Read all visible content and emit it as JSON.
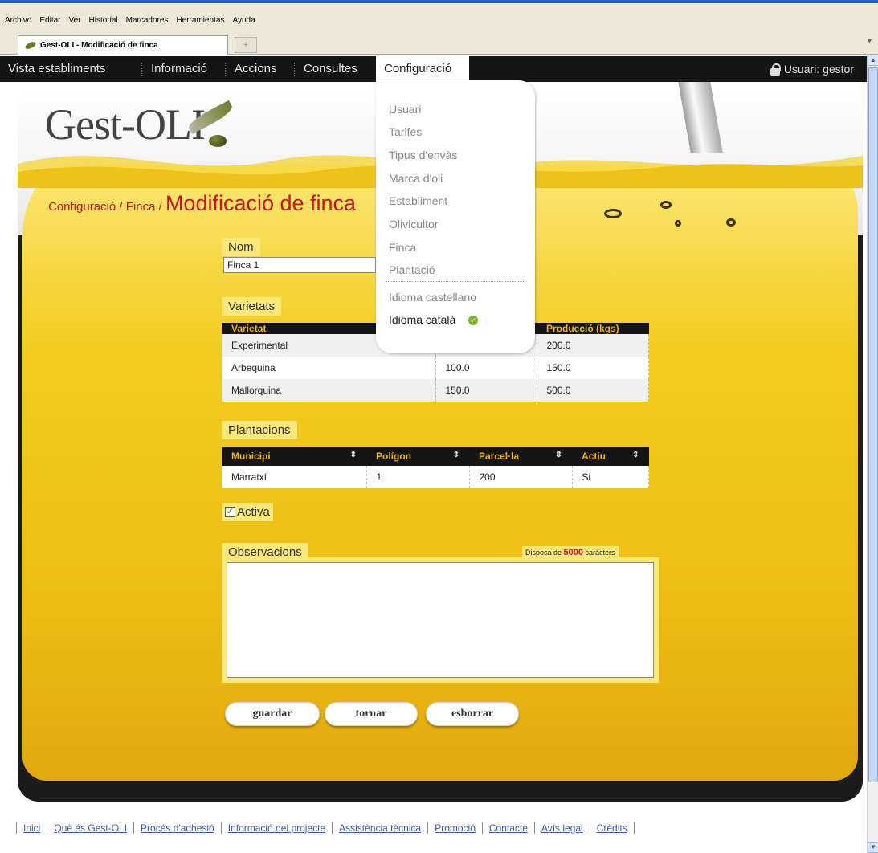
{
  "browser": {
    "menus": [
      "Archivo",
      "Editar",
      "Ver",
      "Historial",
      "Marcadores",
      "Herramientas",
      "Ayuda"
    ],
    "tab_title": "Gest-OLI - Modificació de finca",
    "new_tab": "+"
  },
  "nav": {
    "items": [
      "Vista establiments",
      "Informació",
      "Accions",
      "Consultes",
      "Configuració"
    ],
    "user_label": "Usuari: gestor"
  },
  "logo": "Gest-OLI",
  "breadcrumb": {
    "part1": "Configuració",
    "sep1": " / ",
    "part2": "Finca",
    "sep2": " / ",
    "title": "Modificació de finca"
  },
  "form": {
    "nom_label": "Nom",
    "nom_value": "Finca 1",
    "varietats_label": "Varietats",
    "plantacions_label": "Plantacions",
    "activa_label": "Activa",
    "activa_checked": true,
    "observacions_label": "Observacions",
    "chars_prefix": "Disposa de ",
    "chars_count": "5000",
    "chars_suffix": " caràcters"
  },
  "varietats_table": {
    "headers": [
      "Varietat",
      "",
      "Producció (kgs)"
    ],
    "rows": [
      [
        "Experimental",
        "",
        "200.0"
      ],
      [
        "Arbequina",
        "100.0",
        "150.0"
      ],
      [
        "Mallorquina",
        "150.0",
        "500.0"
      ]
    ]
  },
  "plantacions_table": {
    "headers": [
      "Municipi",
      "Polígon",
      "Parcel·la",
      "Actiu"
    ],
    "rows": [
      [
        "Marratxí",
        "1",
        "200",
        "Si"
      ]
    ]
  },
  "buttons": {
    "save": "guardar",
    "back": "tornar",
    "delete": "esborrar"
  },
  "dropdown": {
    "items": [
      "Usuari",
      "Tarifes",
      "Tipus d'envàs",
      "Marca d'oli",
      "Establiment",
      "Olivicultor",
      "Finca",
      "Plantació"
    ],
    "lang_es": "Idioma castellano",
    "lang_ca": "Idioma català"
  },
  "footer": [
    "Inici",
    "Què és Gest-OLI",
    "Procés d'adhesió",
    "Informació del projecte",
    "Assistència tècnica",
    "Promoció",
    "Contacte",
    "Avís legal",
    "Crèdits"
  ],
  "colors": {
    "accent_red": "#c4161c",
    "oil_yellow": "#f2cc1d",
    "nav_dark": "#141414",
    "label_yellow": "#fce77a"
  }
}
